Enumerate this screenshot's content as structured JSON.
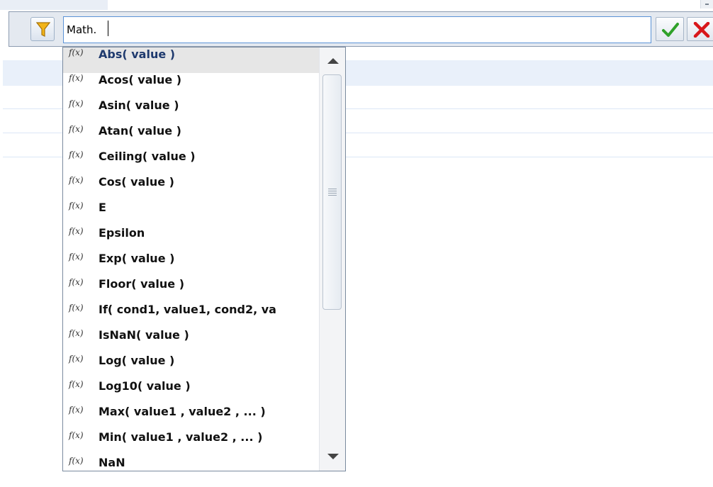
{
  "filter": {
    "value": "Math.",
    "filter_icon": "funnel-icon",
    "ok_icon": "checkmark-icon",
    "cancel_icon": "close-icon"
  },
  "autocomplete": {
    "item_icon_label": "f(x)",
    "items": [
      "Abs( value )",
      "Acos( value )",
      "Asin( value )",
      "Atan( value )",
      "Ceiling( value )",
      "Cos( value )",
      "E",
      "Epsilon",
      "Exp( value )",
      "Floor( value )",
      "If( cond1, value1, cond2, va",
      "IsNaN( value )",
      "Log( value )",
      "Log10( value )",
      "Max( value1 , value2 , ... )",
      "Min( value1 , value2 , ... )",
      "NaN"
    ],
    "selected_index": 0
  },
  "colors": {
    "accent": "#5b92d6",
    "ok_green": "#2fa12a",
    "cancel_red": "#d8171b",
    "funnel": "#f2b418"
  }
}
